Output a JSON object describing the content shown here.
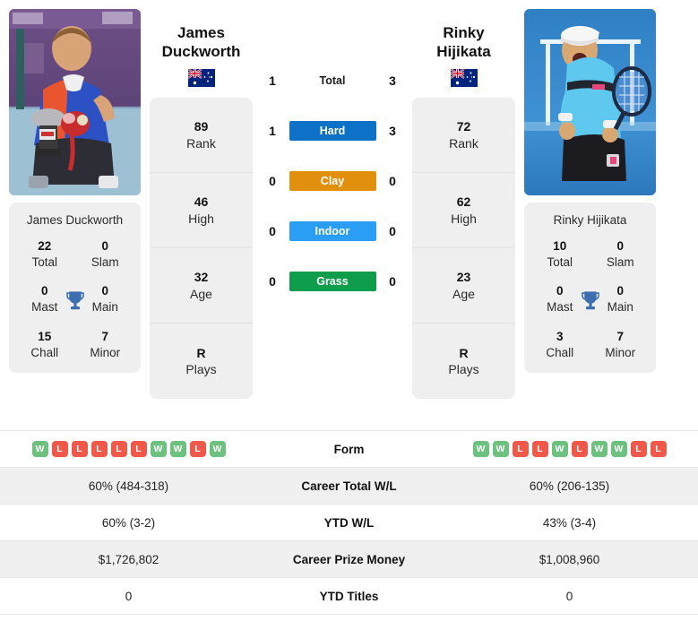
{
  "players": {
    "left": {
      "first_name": "James",
      "last_name": "Duckworth",
      "full_name": "James Duckworth",
      "flag": "australia-flag",
      "photo": "player-photo-trophy-ceremony",
      "stats": [
        {
          "value": "89",
          "label": "Rank"
        },
        {
          "value": "46",
          "label": "High"
        },
        {
          "value": "32",
          "label": "Age"
        },
        {
          "value": "R",
          "label": "Plays"
        }
      ],
      "titles": [
        {
          "value": "22",
          "label": "Total"
        },
        {
          "value": "0",
          "label": "Slam"
        },
        {
          "value": "0",
          "label": "Mast"
        },
        {
          "value": "0",
          "label": "Main"
        },
        {
          "value": "15",
          "label": "Chall"
        },
        {
          "value": "7",
          "label": "Minor"
        }
      ],
      "form": [
        "W",
        "L",
        "L",
        "L",
        "L",
        "L",
        "W",
        "W",
        "L",
        "W"
      ],
      "career_total_wl": "60% (484-318)",
      "ytd_wl": "60% (3-2)",
      "career_prize_money": "$1,726,802",
      "ytd_titles": "0"
    },
    "right": {
      "first_name": "Rinky",
      "last_name": "Hijikata",
      "full_name": "Rinky Hijikata",
      "flag": "australia-flag",
      "photo": "player-photo-celebration",
      "stats": [
        {
          "value": "72",
          "label": "Rank"
        },
        {
          "value": "62",
          "label": "High"
        },
        {
          "value": "23",
          "label": "Age"
        },
        {
          "value": "R",
          "label": "Plays"
        }
      ],
      "titles": [
        {
          "value": "10",
          "label": "Total"
        },
        {
          "value": "0",
          "label": "Slam"
        },
        {
          "value": "0",
          "label": "Mast"
        },
        {
          "value": "0",
          "label": "Main"
        },
        {
          "value": "3",
          "label": "Chall"
        },
        {
          "value": "7",
          "label": "Minor"
        }
      ],
      "form": [
        "W",
        "W",
        "L",
        "L",
        "W",
        "L",
        "W",
        "W",
        "L",
        "L"
      ],
      "career_total_wl": "60% (206-135)",
      "ytd_wl": "43% (3-4)",
      "career_prize_money": "$1,008,960",
      "ytd_titles": "0"
    }
  },
  "head_to_head": [
    {
      "surface": "Total",
      "left": "1",
      "right": "3",
      "color": "transparent"
    },
    {
      "surface": "Hard",
      "left": "1",
      "right": "3",
      "color": "#0e71c8"
    },
    {
      "surface": "Clay",
      "left": "0",
      "right": "0",
      "color": "#e0900c"
    },
    {
      "surface": "Indoor",
      "left": "0",
      "right": "0",
      "color": "#2a9df4"
    },
    {
      "surface": "Grass",
      "left": "0",
      "right": "0",
      "color": "#0e9d4b"
    }
  ],
  "table_rows": [
    {
      "label": "Form",
      "type": "form"
    },
    {
      "label": "Career Total W/L",
      "type": "text",
      "left": "60% (484-318)",
      "right": "60% (206-135)"
    },
    {
      "label": "YTD W/L",
      "type": "text",
      "left": "60% (3-2)",
      "right": "43% (3-4)"
    },
    {
      "label": "Career Prize Money",
      "type": "text",
      "left": "$1,726,802",
      "right": "$1,008,960"
    },
    {
      "label": "YTD Titles",
      "type": "text",
      "left": "0",
      "right": "0"
    }
  ],
  "colors": {
    "win": "#6cc17f",
    "loss": "#f0584a",
    "card_bg": "#efefef",
    "row_shade": "#f0f0f0",
    "trophy": "#3d6fb0"
  }
}
